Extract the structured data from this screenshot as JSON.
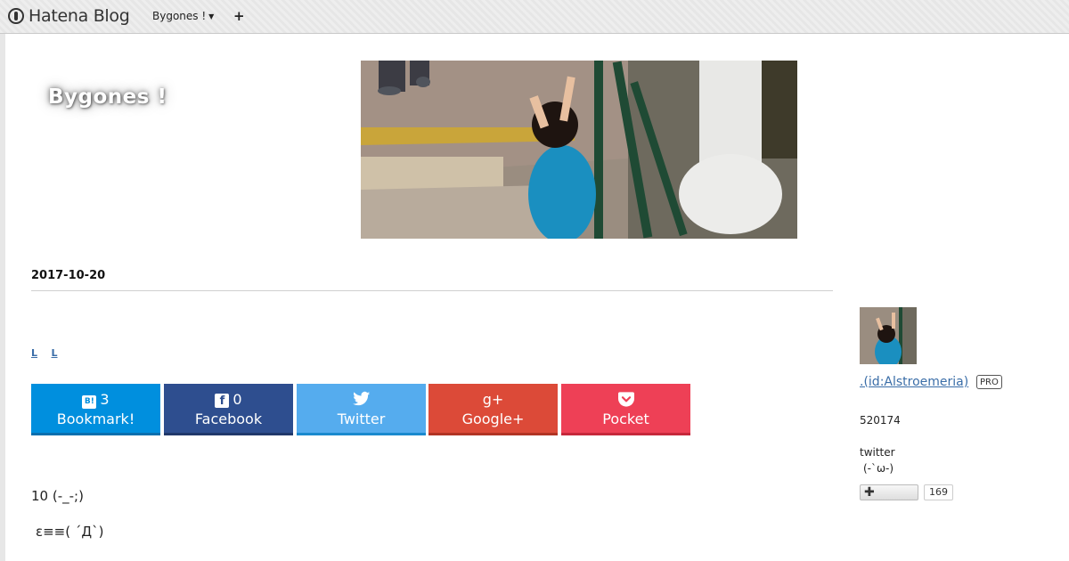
{
  "globalheader": {
    "logo_text": "Hatena Blog",
    "blog_menu_label": "Bygones !",
    "add_label": "+"
  },
  "blog": {
    "title": "Bygones !"
  },
  "entry": {
    "date": "2017-10-20",
    "tags": [
      "L",
      "L"
    ],
    "body": [
      "10 (-_-;)",
      "ε≡≡( ´Д`)"
    ]
  },
  "share": {
    "hatena": {
      "icon": "B!",
      "count": "3",
      "label": "Bookmark!"
    },
    "facebook": {
      "icon": "f",
      "count": "0",
      "label": "Facebook"
    },
    "twitter": {
      "label": "Twitter"
    },
    "google": {
      "icon": "g+",
      "label": "Google+"
    },
    "pocket": {
      "label": "Pocket"
    }
  },
  "sidebar": {
    "author_link": ".(id:Alstroemeria)",
    "pro_badge": "PRO",
    "readers": "520174",
    "twitter_label": "twitter",
    "twitter_face": "(-`ω-)",
    "subscribe_count": "169"
  },
  "colors": {
    "hatena": "#008fde",
    "facebook": "#2e4e8f",
    "twitter": "#55acee",
    "google": "#dc4a38",
    "pocket": "#ee4056",
    "link": "#3b6ea8"
  }
}
